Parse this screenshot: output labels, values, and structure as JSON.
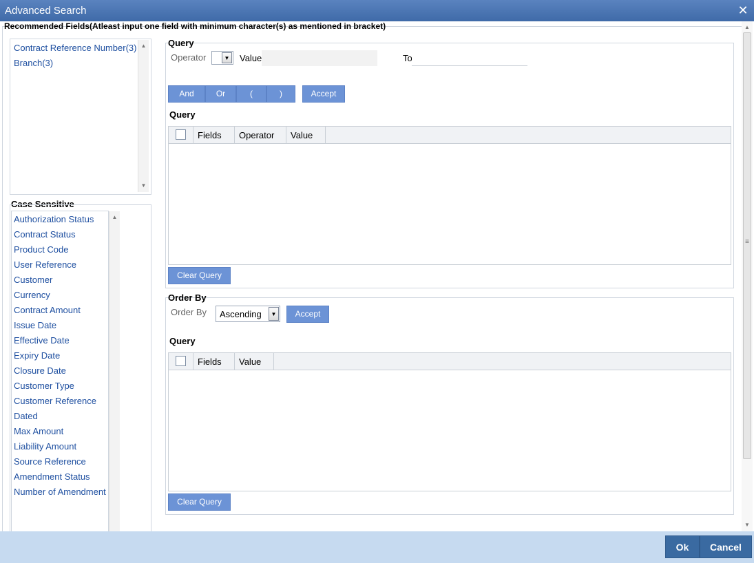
{
  "window": {
    "title": "Advanced Search",
    "close_glyph": "✕"
  },
  "recommended": {
    "label": "Recommended Fields(Atleast input one field with minimum character(s) as mentioned in bracket)",
    "items": [
      "Contract Reference Number(3)",
      "Branch(3)"
    ]
  },
  "case_sensitive": {
    "label": "Case Sensitive",
    "items": [
      "Authorization Status",
      "Contract Status",
      "Product Code",
      "User Reference",
      "Customer",
      "Currency",
      "Contract Amount",
      "Issue Date",
      "Effective Date",
      "Expiry Date",
      "Closure Date",
      "Customer Type",
      "Customer Reference",
      "Dated",
      "Max Amount",
      "Liability Amount",
      "Source Reference",
      "Amendment Status",
      "Number of Amendment"
    ]
  },
  "query": {
    "title": "Query",
    "operator_label": "Operator",
    "operator_value": "",
    "value_label": "Value",
    "to_label": "To",
    "buttons": {
      "and": "And",
      "or": "Or",
      "open_paren": "(",
      "close_paren": ")",
      "accept": "Accept"
    },
    "grid_title": "Query",
    "columns": [
      "Fields",
      "Operator",
      "Value"
    ],
    "clear_label": "Clear Query"
  },
  "order_by": {
    "title": "Order By",
    "label": "Order By",
    "selected": "Ascending",
    "accept": "Accept",
    "grid_title": "Query",
    "columns": [
      "Fields",
      "Value"
    ],
    "clear_label": "Clear Query"
  },
  "footer": {
    "ok": "Ok",
    "cancel": "Cancel"
  },
  "icons": {
    "dropdown": "▼",
    "scroll_up": "▲",
    "scroll_down": "▼",
    "grip": "≡"
  },
  "colors": {
    "title_bar": "#4a75b3",
    "button": "#6c93d6",
    "footer": "#c6daf0",
    "footer_button": "#3a6aa1",
    "link_text": "#1e4fa0"
  }
}
